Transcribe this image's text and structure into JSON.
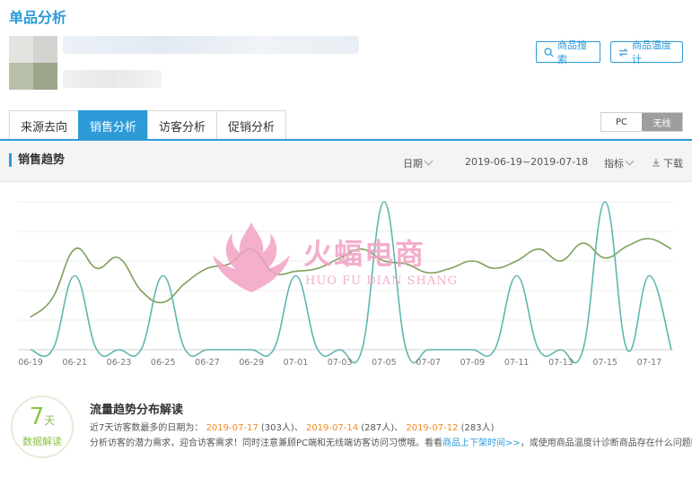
{
  "page_title": "单品分析",
  "header_buttons": {
    "search": "商品搜索",
    "temperature": "商品温度计"
  },
  "tabs": [
    {
      "label": "来源去向",
      "active": false
    },
    {
      "label": "销售分析",
      "active": true
    },
    {
      "label": "访客分析",
      "active": false
    },
    {
      "label": "促销分析",
      "active": false
    }
  ],
  "device_switch": {
    "options": [
      "PC",
      "无线"
    ],
    "selected": "无线"
  },
  "trend": {
    "title": "销售趋势",
    "date_label": "日期",
    "date_range": "2019-06-19~2019-07-18",
    "metric_label": "指标",
    "download_label": "下载"
  },
  "watermark": {
    "text": "火蝠电商",
    "sub": "HUO FU DIAN SHANG"
  },
  "colors": {
    "accent": "#2d9bd8",
    "series_green": "#7ea05a",
    "series_teal": "#5fb6b0",
    "highlight": "#f08a24",
    "badge": "#8bc34a"
  },
  "chart_data": {
    "type": "line",
    "x": [
      "06-19",
      "06-20",
      "06-21",
      "06-22",
      "06-23",
      "06-24",
      "06-25",
      "06-26",
      "06-27",
      "06-28",
      "06-29",
      "06-30",
      "07-01",
      "07-02",
      "07-03",
      "07-04",
      "07-05",
      "07-06",
      "07-07",
      "07-08",
      "07-09",
      "07-10",
      "07-11",
      "07-12",
      "07-13",
      "07-14",
      "07-15",
      "07-16",
      "07-17",
      "07-18"
    ],
    "tick_labels": [
      "06-19",
      "06-21",
      "06-23",
      "06-25",
      "06-27",
      "06-29",
      "07-01",
      "07-03",
      "07-05",
      "07-07",
      "07-09",
      "07-11",
      "07-13",
      "07-15",
      "07-17"
    ],
    "ylim": [
      0,
      100
    ],
    "grid": true,
    "series": [
      {
        "values": [
          22,
          35,
          68,
          55,
          62,
          40,
          32,
          45,
          55,
          58,
          68,
          52,
          53,
          55,
          62,
          68,
          60,
          58,
          52,
          55,
          60,
          55,
          60,
          68,
          60,
          72,
          62,
          70,
          75,
          68
        ]
      },
      {
        "values": [
          0,
          0,
          50,
          0,
          0,
          0,
          50,
          0,
          0,
          0,
          0,
          0,
          50,
          0,
          0,
          0,
          100,
          0,
          0,
          0,
          0,
          0,
          50,
          0,
          0,
          0,
          100,
          0,
          50,
          0
        ]
      }
    ]
  },
  "info": {
    "badge_num": "7",
    "badge_unit": "天",
    "badge_text": "数据解读",
    "title": "流量趋势分布解读",
    "line1_prefix": "近7天访客数最多的日期为：",
    "dates": [
      {
        "date": "2019-07-17",
        "count": "(303人)"
      },
      {
        "date": "2019-07-14",
        "count": "(287人)"
      },
      {
        "date": "2019-07-12",
        "count": "(283人)"
      }
    ],
    "separator": "、",
    "line2_prefix": "分析访客的潜力需求，迎合访客需求！同时注意兼顾PC端和无线端访客访问习惯哦。看看",
    "line2_link": "商品上下架时间>>",
    "line2_suffix": "，或使用商品温度计诊断商品存在什么问题吧。"
  }
}
